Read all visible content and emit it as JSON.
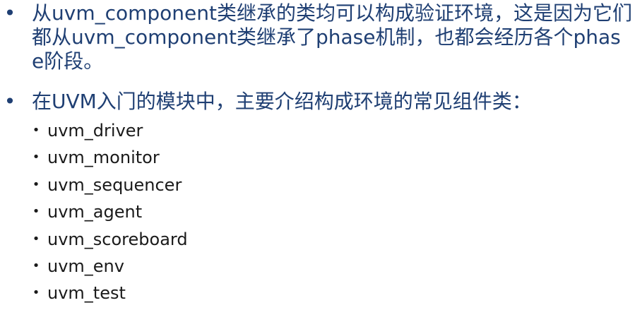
{
  "bullets": [
    {
      "marker": "•",
      "text": "从uvm_component类继承的类均可以构成验证环境，这是因为它们都从uvm_component类继承了phase机制，也都会经历各个phase阶段。"
    },
    {
      "marker": "•",
      "text": "在UVM入门的模块中，主要介绍构成环境的常见组件类：",
      "sub_marker": "•",
      "sub_items": [
        "uvm_driver",
        "uvm_monitor",
        "uvm_sequencer",
        "uvm_agent",
        "uvm_scoreboard",
        "uvm_env",
        "uvm_test"
      ]
    }
  ]
}
